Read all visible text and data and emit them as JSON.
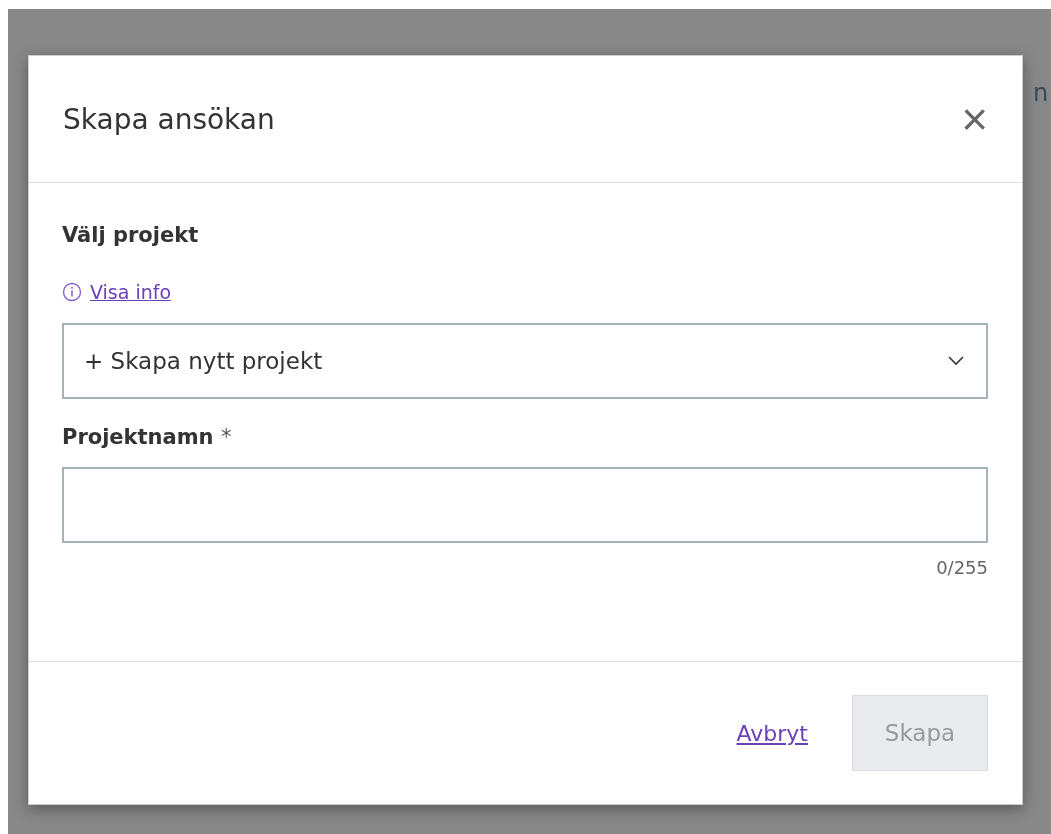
{
  "background": {
    "text_fragment": "n"
  },
  "dialog": {
    "title": "Skapa ansökan",
    "close_label": "×",
    "fields": [
      {
        "kind": "select",
        "label": "Välj projekt",
        "info_link": "Visa info",
        "value": "+ Skapa nytt projekt"
      },
      {
        "kind": "text",
        "label": "Projektnamn",
        "required": true,
        "required_mark": "*",
        "counter": "0/255"
      }
    ],
    "buttons": [
      {
        "kind": "link",
        "label": "Avbryt",
        "disabled": false
      },
      {
        "kind": "primary",
        "label": "Skapa",
        "disabled": true
      }
    ]
  }
}
